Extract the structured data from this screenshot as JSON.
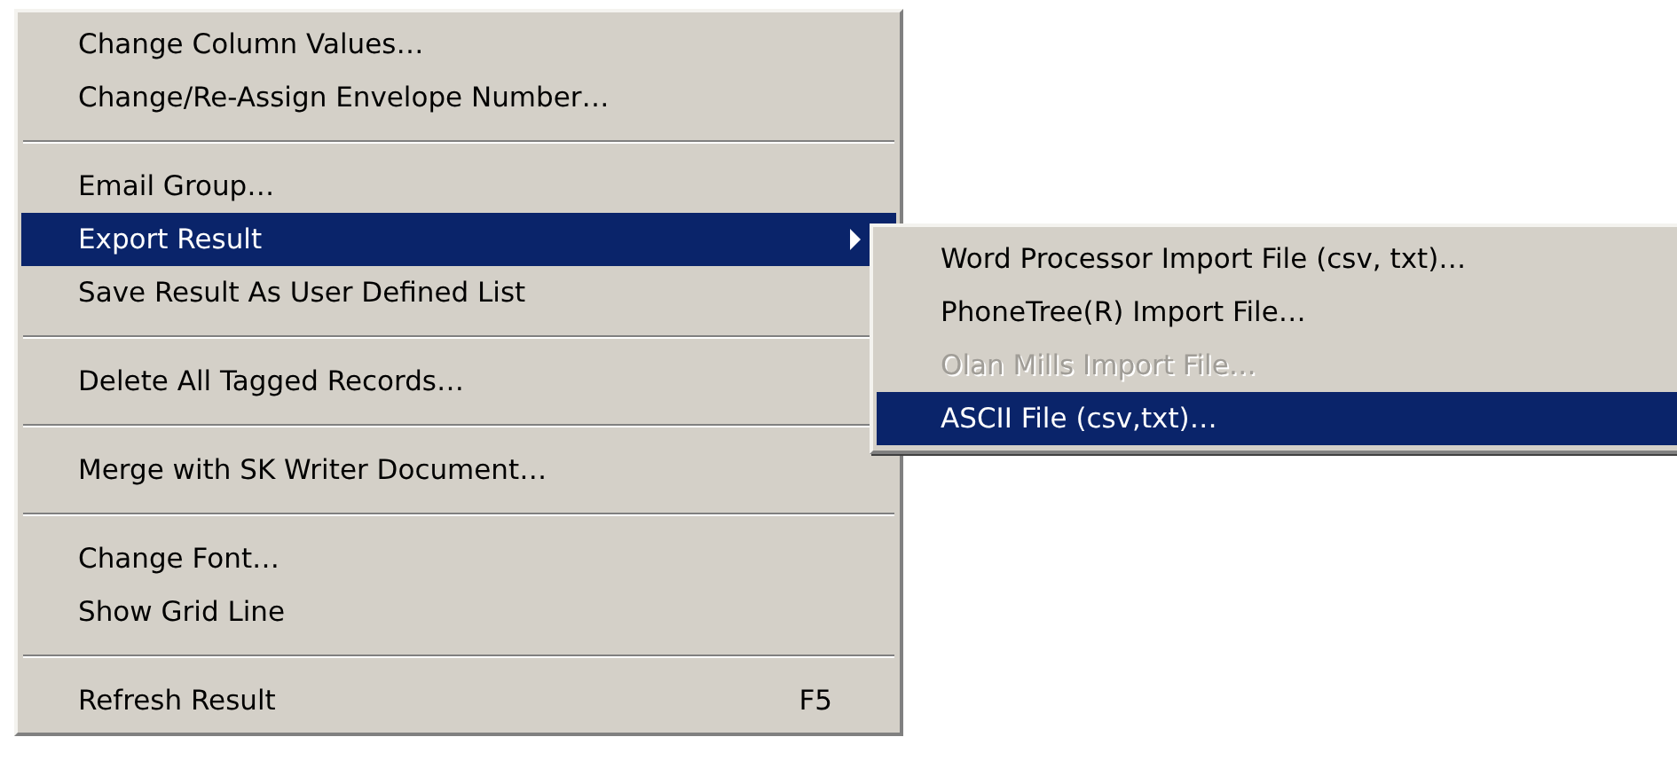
{
  "menu": {
    "items": [
      {
        "kind": "item",
        "label": "Change Column Values…",
        "selected": false
      },
      {
        "kind": "item",
        "label": "Change/Re-Assign Envelope Number…",
        "selected": false
      },
      {
        "kind": "separator"
      },
      {
        "kind": "item",
        "label": "Email Group…",
        "selected": false
      },
      {
        "kind": "item",
        "label": "Export Result",
        "selected": true,
        "has_submenu": true
      },
      {
        "kind": "item",
        "label": "Save Result As User Defined List",
        "selected": false
      },
      {
        "kind": "separator"
      },
      {
        "kind": "item",
        "label": "Delete All Tagged Records…",
        "selected": false
      },
      {
        "kind": "separator"
      },
      {
        "kind": "item",
        "label": "Merge with SK Writer Document…",
        "selected": false
      },
      {
        "kind": "separator"
      },
      {
        "kind": "item",
        "label": "Change Font…",
        "selected": false
      },
      {
        "kind": "item",
        "label": "Show Grid Line",
        "selected": false
      },
      {
        "kind": "separator"
      },
      {
        "kind": "item",
        "label": "Refresh Result",
        "selected": false,
        "shortcut": "F5"
      }
    ]
  },
  "submenu": {
    "items": [
      {
        "label": "Word Processor Import File (csv, txt)…",
        "selected": false,
        "disabled": false
      },
      {
        "label": "PhoneTree(R) Import File…",
        "selected": false,
        "disabled": false
      },
      {
        "label": "Olan Mills Import File…",
        "selected": false,
        "disabled": true
      },
      {
        "label": "ASCII File (csv,txt)…",
        "selected": true,
        "disabled": false
      }
    ]
  }
}
